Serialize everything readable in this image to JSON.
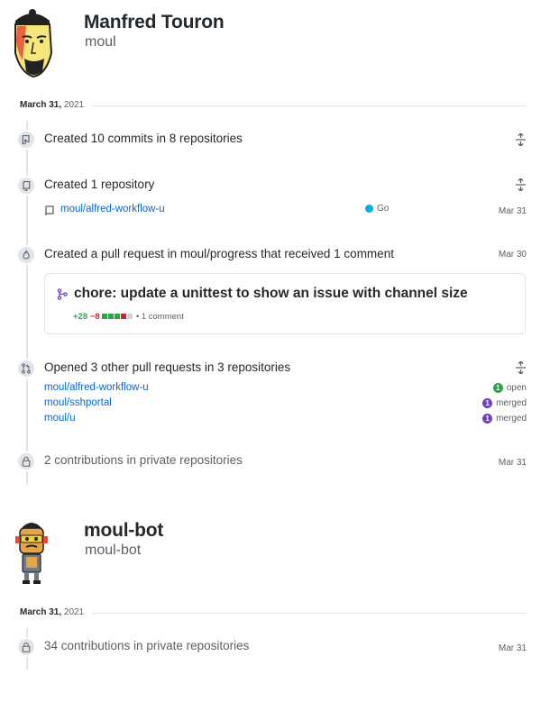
{
  "user1": {
    "name": "Manfred Touron",
    "login": "moul",
    "date_month_day": "March 31,",
    "date_year": "2021",
    "events": {
      "commits": {
        "text": "Created 10 commits in 8 repositories"
      },
      "repo": {
        "text": "Created 1 repository",
        "repo_name": "moul/alfred-workflow-u",
        "language": "Go",
        "language_color": "#00ADD8",
        "date": "Mar 31"
      },
      "pr": {
        "text": "Created a pull request in moul/progress that received 1 comment",
        "date": "Mar 30",
        "title": "chore: update a unittest to show an issue with channel size",
        "additions": "+28",
        "deletions": "−8",
        "comments": "• 1 comment"
      },
      "opened": {
        "text": "Opened 3 other pull requests in 3 repositories",
        "items": [
          {
            "repo": "moul/alfred-workflow-u",
            "count": "1",
            "status": "open",
            "color": "#28a745"
          },
          {
            "repo": "moul/sshportal",
            "count": "1",
            "status": "merged",
            "color": "#6f42c1"
          },
          {
            "repo": "moul/u",
            "count": "1",
            "status": "merged",
            "color": "#6f42c1"
          }
        ]
      },
      "private": {
        "text": "2 contributions in private repositories",
        "date": "Mar 31"
      }
    }
  },
  "user2": {
    "name": "moul-bot",
    "login": "moul-bot",
    "date_month_day": "March 31,",
    "date_year": "2021",
    "events": {
      "private": {
        "text": "34 contributions in private repositories",
        "date": "Mar 31"
      }
    }
  }
}
